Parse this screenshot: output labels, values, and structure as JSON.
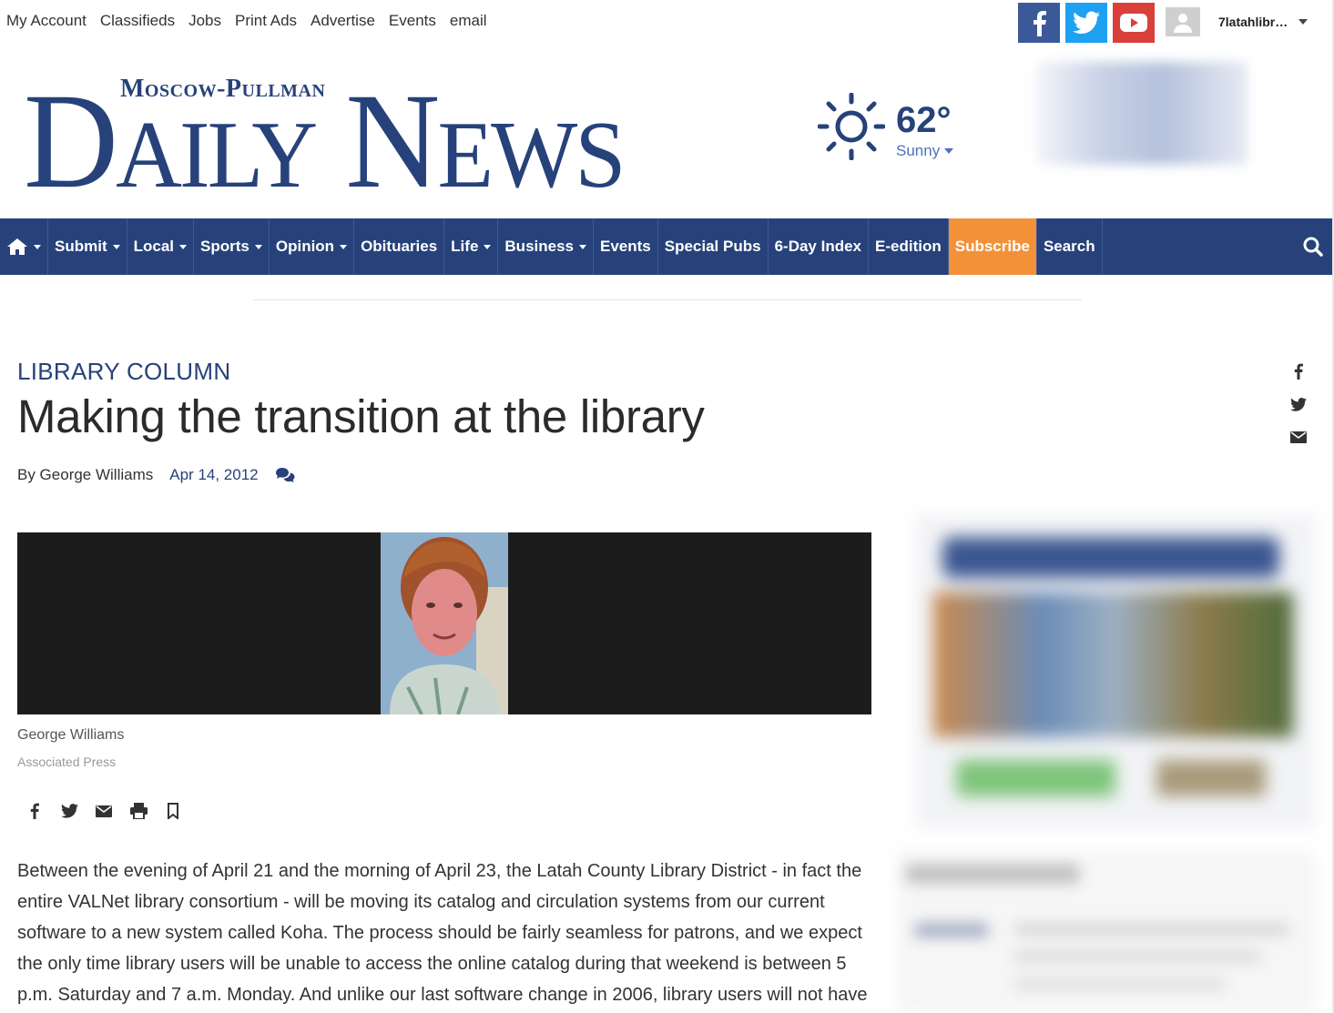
{
  "utility": {
    "links": [
      "My Account",
      "Classifieds",
      "Jobs",
      "Print Ads",
      "Advertise",
      "Events",
      "email"
    ],
    "social": [
      "facebook-icon",
      "twitter-icon",
      "youtube-icon"
    ],
    "username": "7latahlibr…"
  },
  "masthead": {
    "logo_small": "Moscow-Pullman",
    "logo_big": "Daily News",
    "weather": {
      "temp": "62°",
      "condition": "Sunny",
      "icon": "sun-icon"
    }
  },
  "nav": {
    "items": [
      {
        "label": "Submit",
        "dropdown": true
      },
      {
        "label": "Local",
        "dropdown": true
      },
      {
        "label": "Sports",
        "dropdown": true
      },
      {
        "label": "Opinion",
        "dropdown": true
      },
      {
        "label": "Obituaries",
        "dropdown": false
      },
      {
        "label": "Life",
        "dropdown": true
      },
      {
        "label": "Business",
        "dropdown": true
      },
      {
        "label": "Events",
        "dropdown": false
      },
      {
        "label": "Special Pubs",
        "dropdown": false
      },
      {
        "label": "6-Day Index",
        "dropdown": false
      },
      {
        "label": "E-edition",
        "dropdown": false
      },
      {
        "label": "Subscribe",
        "dropdown": false,
        "highlight": true
      },
      {
        "label": "Search",
        "dropdown": false
      }
    ],
    "accent": "#27427a",
    "subscribe_color": "#f39139"
  },
  "article": {
    "kicker": "LIBRARY COLUMN",
    "headline": "Making the transition at the library",
    "author": "By George Williams",
    "date": "Apr 14, 2012",
    "photo_caption": "George Williams",
    "photo_credit": "Associated Press",
    "body": "Between the evening of April 21 and the morning of April 23, the Latah County Library District - in fact the entire VALNet library consortium - will be moving its catalog and circulation systems from our current software to a new system called Koha. The process should be fairly seamless for patrons, and we expect the only time library users will be unable to access the online catalog during that weekend is between 5 p.m. Saturday and 7 a.m. Monday. And unlike our last software change in 2006, library users will not have"
  }
}
